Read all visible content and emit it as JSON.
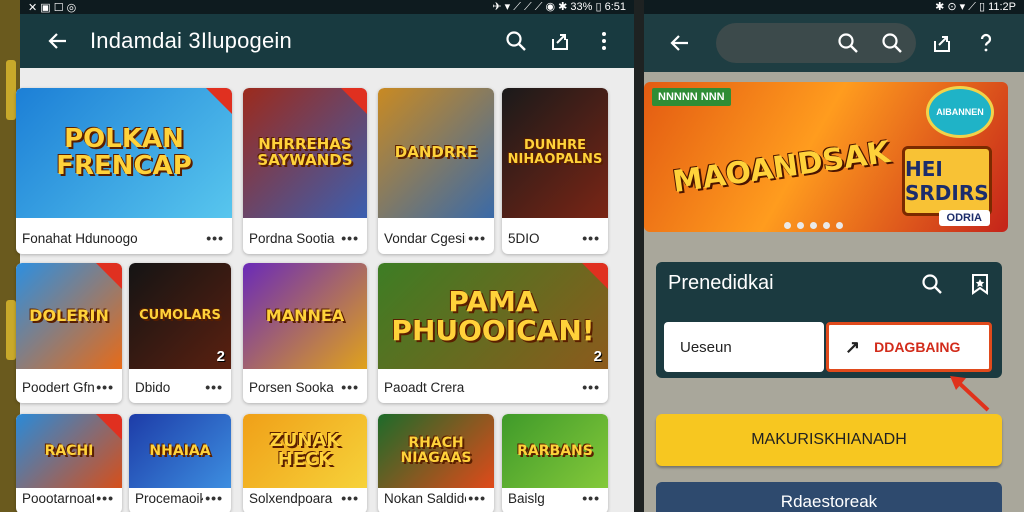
{
  "left": {
    "status": {
      "icons_text": "✕ ▣ ☐ ◎",
      "right_text": "✈ ▾ ⟋ ⟋ ⟋ ◉ ✱ 33% ▯ 6:51"
    },
    "appbar": {
      "title": "Indamdai 3Ilupogein"
    },
    "cards": [
      {
        "art": "POLKAN FRENCAP",
        "caption": "Fonahat Hdunoogo",
        "colors": [
          "#1c7fd6",
          "#58c6ee"
        ],
        "has_badge": true
      },
      {
        "art": "NHRREHAS SAYWANDS",
        "caption": "Pordna Sootia",
        "colors": [
          "#9c2a1c",
          "#3b5fb0"
        ],
        "has_badge": true
      },
      {
        "art": "DANDRRE",
        "caption": "Vondar Cgesinno..",
        "colors": [
          "#c98a22",
          "#3a6aa8"
        ],
        "has_badge": false
      },
      {
        "art": "DUNHRE NIHAOPALNS",
        "caption": "5DIO",
        "colors": [
          "#1a1a1a",
          "#7a2515"
        ],
        "has_badge": false
      },
      {
        "art": "DOLERIN",
        "caption": "Poodert Gfnenoals",
        "colors": [
          "#2d8fe0",
          "#e76b18"
        ],
        "has_badge": true
      },
      {
        "art": "CUMOLARS",
        "caption": "Dbido",
        "colors": [
          "#141414",
          "#5a2010"
        ],
        "has_badge": false,
        "number": "2"
      },
      {
        "art": "MANNEA",
        "caption": "Porsen Sooka",
        "colors": [
          "#6a2ab8",
          "#e0a21c"
        ],
        "has_badge": false
      },
      {
        "art": "PAMA PHUOOICAN!",
        "caption": "Paoadt Crera",
        "colors": [
          "#3d7d24",
          "#8c5a1c"
        ],
        "has_badge": true,
        "number": "2"
      },
      {
        "art": "RACHI",
        "caption": "Poootarnoatso",
        "colors": [
          "#2a8ad8",
          "#d64f1a"
        ],
        "has_badge": true
      },
      {
        "art": "NHAIAA",
        "caption": "Procemaoik",
        "colors": [
          "#1d3ca8",
          "#3d8ee0"
        ],
        "has_badge": false
      },
      {
        "art": "ZUNAK HECK",
        "caption": "Solxendpoara",
        "colors": [
          "#f0a018",
          "#f6d23a"
        ],
        "has_badge": false
      },
      {
        "art": "RHACH NIAGAAS",
        "caption": "Nokan Saldideaa..",
        "colors": [
          "#1d6b2a",
          "#e04a1a"
        ],
        "has_badge": false
      },
      {
        "art": "RARBANS",
        "caption": "Baislg",
        "colors": [
          "#3f9a2a",
          "#84c93a"
        ],
        "has_badge": false
      }
    ]
  },
  "right": {
    "status": {
      "right_text": "✱ ⊙ ▾ ⟋ ▯ 11:2P"
    },
    "hero": {
      "title": "MAOANDSAK",
      "tag": "NNNNN NNN",
      "box_text": "HEI SRDIRS",
      "circle_text": "AIBANNEN",
      "strip_text": "ODRIA"
    },
    "panel": {
      "title": "Prenedidkai",
      "field_left": "Ueseun",
      "field_right": "DDAGBAING"
    },
    "buttons": {
      "primary": "MAKURISKHIANADH",
      "secondary": "Rdaestoreak"
    }
  }
}
